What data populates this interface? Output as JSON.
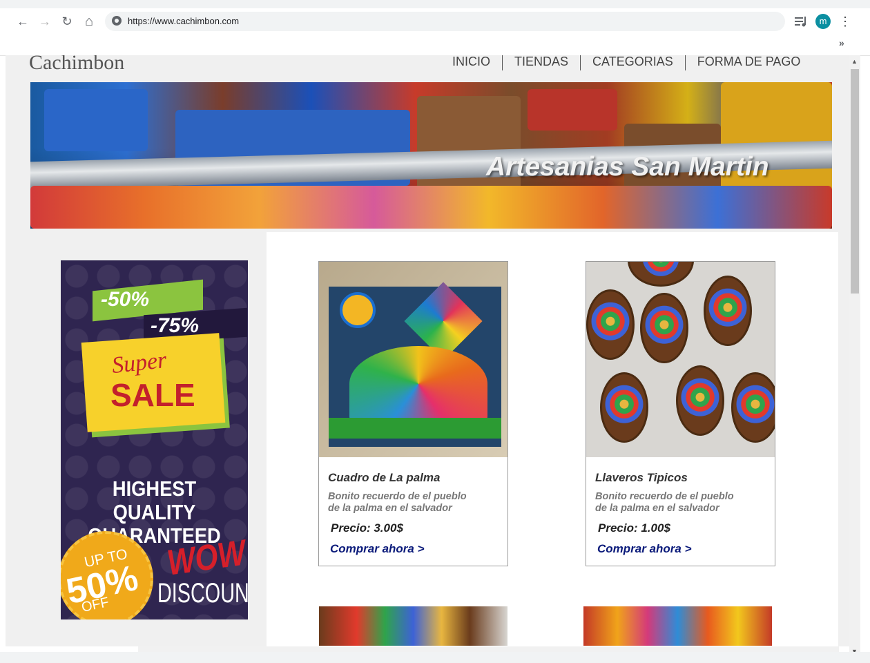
{
  "browser": {
    "url": "https://www.cachimbon.com",
    "avatar_letter": "m",
    "back_icon": "←",
    "forward_icon": "→",
    "reload_icon": "↻",
    "home_icon": "⌂",
    "menu_icon": "⋮",
    "overflow_icon": "»"
  },
  "site": {
    "brand": "Cachimbon",
    "nav": [
      "INICIO",
      "TIENDAS",
      "CATEGORIAS",
      "FORMA DE PAGO"
    ],
    "hero_title": "Artesanias San Martin"
  },
  "ad": {
    "pct_a": "-50%",
    "pct_b": "-75%",
    "super": "Super",
    "sale": "SALE",
    "quality_line1": "HIGHEST QUALITY",
    "quality_line2": "GUARANTEED",
    "seal_upto": "UP TO",
    "seal_pct": "50%",
    "seal_off": "OFF",
    "wow": "WOW!",
    "discount": "DISCOUNT",
    "colors": {
      "background": "#2f2550",
      "accent_green": "#8bc43f",
      "accent_yellow": "#f7d12b",
      "accent_red": "#c3202c"
    }
  },
  "products": [
    {
      "name": "Cuadro de La palma",
      "desc_line1": "Bonito recuerdo de el pueblo",
      "desc_line2": "de la palma en el salvador",
      "price": "Precio: 3.00$",
      "cta": "Comprar ahora >"
    },
    {
      "name": "Llaveros Tipicos",
      "desc_line1": "Bonito recuerdo de el pueblo",
      "desc_line2": "de la palma en el salvador",
      "price": "Precio: 1.00$",
      "cta": "Comprar ahora >"
    }
  ]
}
